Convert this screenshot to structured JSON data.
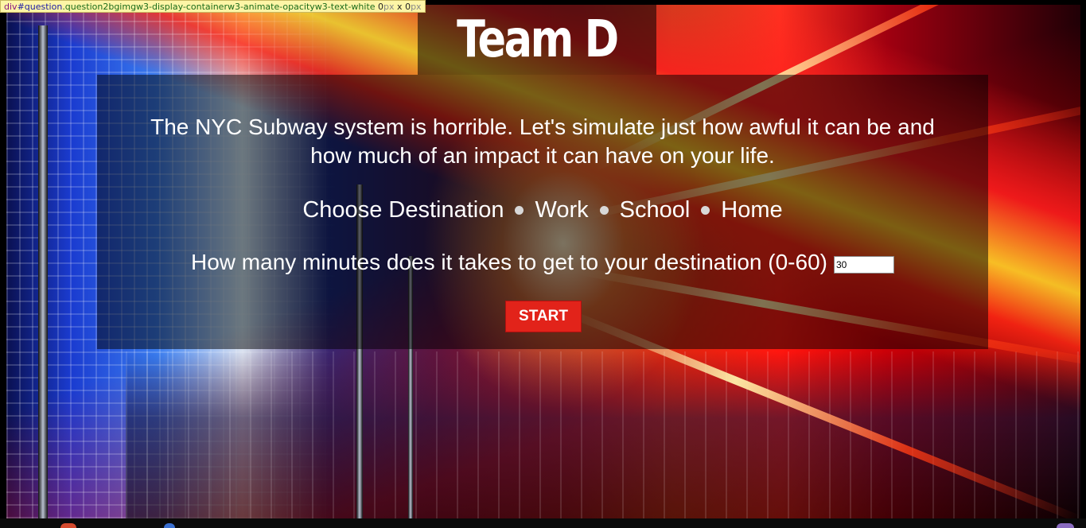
{
  "devtools_tip": {
    "tag": "div",
    "id": "#question",
    "classes": ".question2bgimgw3-display-containerw3-animate-opacityw3-text-white",
    "width": "0",
    "width_unit": "px",
    "sep": " x ",
    "height": "0",
    "height_unit": "px"
  },
  "header": {
    "title": "Team D"
  },
  "intro": {
    "line1": "The NYC Subway system is horrible. Let's simulate just how awful it can be and",
    "line2": "how much of an impact it can have on your life."
  },
  "destination": {
    "label": "Choose Destination",
    "options": [
      "Work",
      "School",
      "Home"
    ]
  },
  "minutes": {
    "label": "How many minutes does it takes to get to your destination (0-60)",
    "value": "30"
  },
  "start_button": {
    "label": "START"
  },
  "colors": {
    "button_red": "#e2231a",
    "text": "#ffffff",
    "overlay": "rgba(0,0,0,0.5)"
  }
}
